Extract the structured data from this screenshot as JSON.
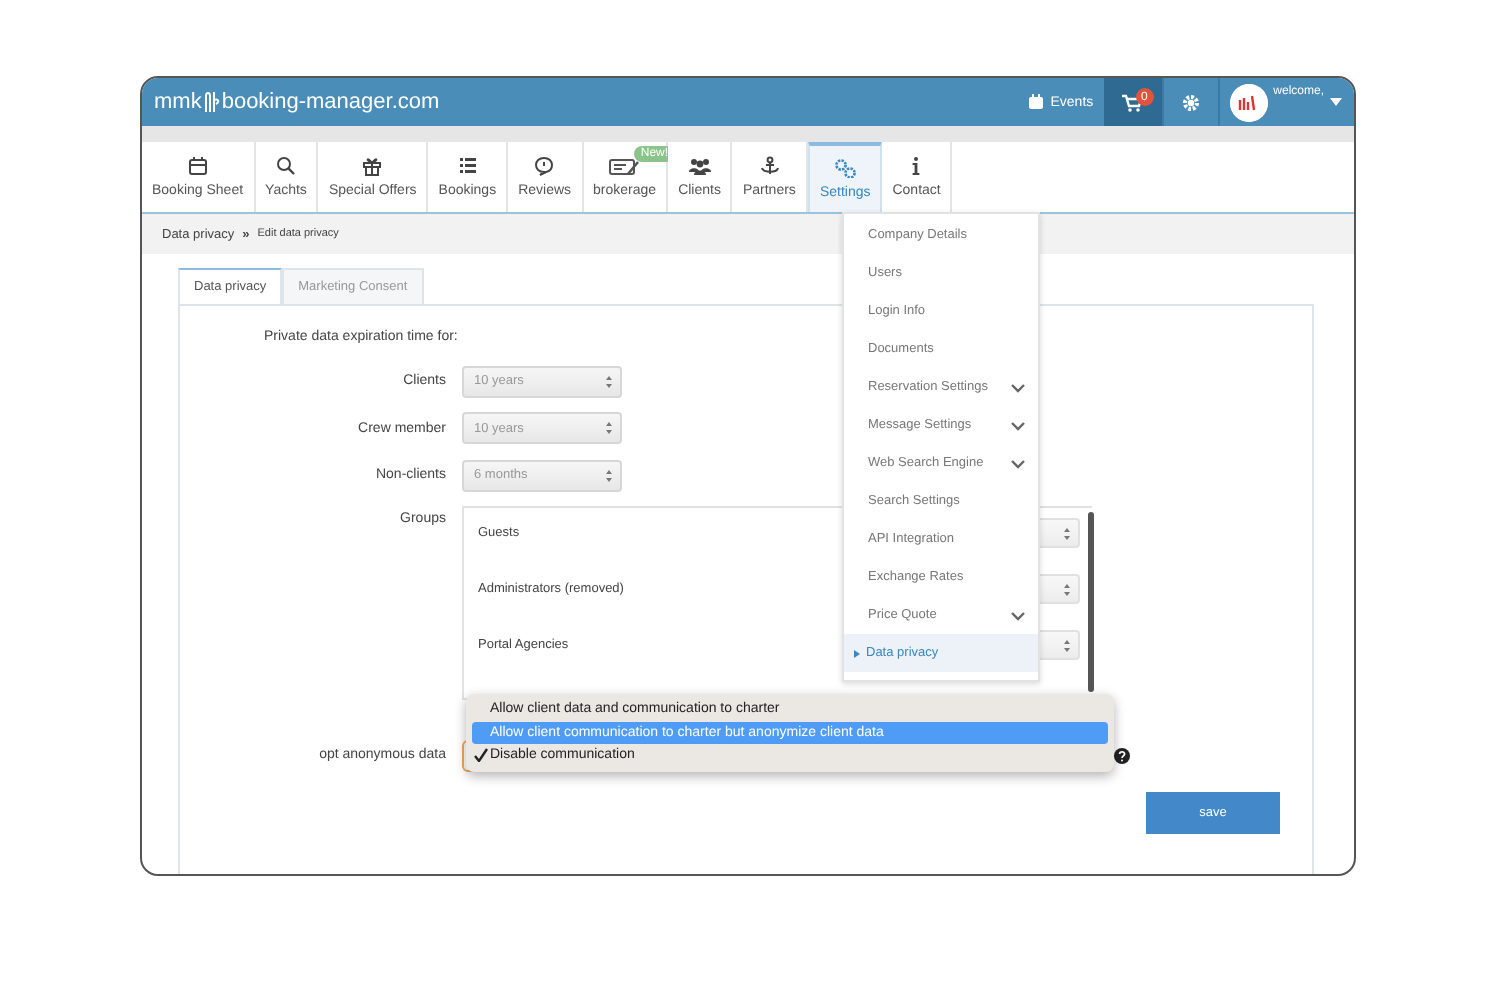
{
  "header": {
    "logo_prefix": "mmk",
    "logo_text": "booking-manager.com",
    "events": "Events",
    "cart_count": "0",
    "welcome": "welcome,"
  },
  "nav": [
    {
      "label": "Booking Sheet",
      "selected": false
    },
    {
      "label": "Yachts",
      "selected": false
    },
    {
      "label": "Special Offers",
      "selected": false
    },
    {
      "label": "Bookings",
      "selected": false
    },
    {
      "label": "Reviews",
      "selected": false
    },
    {
      "label": "brokerage",
      "selected": false,
      "badge": "New!"
    },
    {
      "label": "Clients",
      "selected": false
    },
    {
      "label": "Partners",
      "selected": false
    },
    {
      "label": "Settings",
      "selected": true
    },
    {
      "label": "Contact",
      "selected": false
    }
  ],
  "breadcrumb": {
    "parent": "Data privacy",
    "separator": "»",
    "current": "Edit data privacy"
  },
  "tabs": [
    {
      "label": "Data privacy",
      "selected": true
    },
    {
      "label": "Marketing Consent",
      "selected": false
    }
  ],
  "form": {
    "heading": "Private data expiration time for:",
    "fields": [
      {
        "label": "Clients",
        "value": "10 years"
      },
      {
        "label": "Crew member",
        "value": "10 years"
      },
      {
        "label": "Non-clients",
        "value": "6 months"
      }
    ],
    "groups_label": "Groups",
    "groups": [
      "Guests",
      "Administrators (removed)",
      "Portal Agencies"
    ],
    "opt_label": "opt anonymous data",
    "save": "save"
  },
  "settings_menu": [
    {
      "label": "Company Details",
      "expandable": false,
      "selected": false
    },
    {
      "label": "Users",
      "expandable": false,
      "selected": false
    },
    {
      "label": "Login Info",
      "expandable": false,
      "selected": false
    },
    {
      "label": "Documents",
      "expandable": false,
      "selected": false
    },
    {
      "label": "Reservation Settings",
      "expandable": true,
      "selected": false
    },
    {
      "label": "Message Settings",
      "expandable": true,
      "selected": false
    },
    {
      "label": "Web Search Engine",
      "expandable": true,
      "selected": false
    },
    {
      "label": "Search Settings",
      "expandable": false,
      "selected": false
    },
    {
      "label": "API Integration",
      "expandable": false,
      "selected": false
    },
    {
      "label": "Exchange Rates",
      "expandable": false,
      "selected": false
    },
    {
      "label": "Price Quote",
      "expandable": true,
      "selected": false
    },
    {
      "label": "Data privacy",
      "expandable": false,
      "selected": true
    }
  ],
  "opt_popup": [
    {
      "label": "Allow client data and communication to charter",
      "selected": false,
      "checked": false
    },
    {
      "label": "Allow client communication to charter but anonymize client data",
      "selected": true,
      "checked": false
    },
    {
      "label": "Disable communication",
      "selected": false,
      "checked": true
    }
  ]
}
